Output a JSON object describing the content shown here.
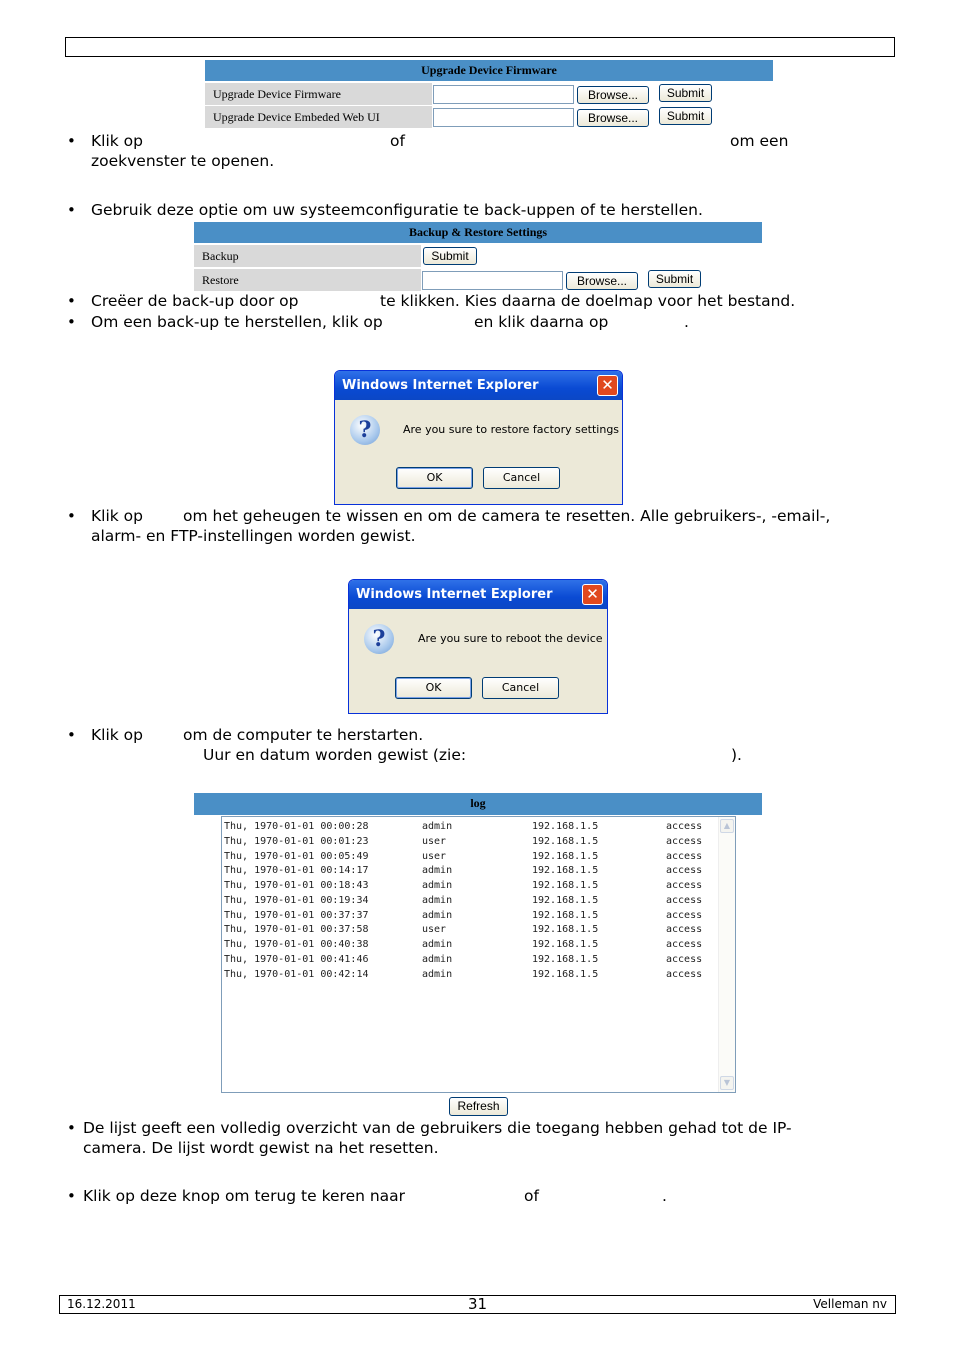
{
  "firmware_panel": {
    "title": "Upgrade Device Firmware",
    "rows": [
      {
        "label": "Upgrade Device Firmware",
        "file_value": "",
        "browse": "Browse...",
        "submit": "Submit"
      },
      {
        "label": "Upgrade Device Embeded Web UI",
        "file_value": "",
        "browse": "Browse...",
        "submit": "Submit"
      }
    ]
  },
  "text": {
    "p1_a": "Klik op",
    "p1_b": "of",
    "p1_c": "om een",
    "p1_d": "zoekvenster te openen.",
    "p2": "Gebruik deze optie om uw systeemconfiguratie te back-uppen of te herstellen.",
    "p3_a": "Creëer de back-up door op",
    "p3_b": "te klikken. Kies daarna de doelmap voor het bestand.",
    "p4_a": "Om een back-up te herstellen, klik op",
    "p4_b": "en klik daarna op",
    "p4_c": ".",
    "p5_a": "Klik op",
    "p5_b": "om het geheugen te wissen en om de camera te resetten. Alle gebruikers-, -email-,",
    "p5_c": "alarm- en FTP-instellingen worden gewist.",
    "p6_a": "Klik op",
    "p6_b": "om de computer te herstarten.",
    "p6_c": "Uur en datum worden gewist (zie:",
    "p6_d": ").",
    "p7_a": "De lijst geeft een volledig overzicht van de gebruikers die toegang hebben gehad tot de IP-",
    "p7_b": "camera. De lijst wordt gewist na het resetten.",
    "p8_a": "Klik op deze knop om terug te keren naar",
    "p8_b": "of",
    "p8_c": ".",
    "bullet": "•"
  },
  "backup_panel": {
    "title": "Backup & Restore Settings",
    "backup_label": "Backup",
    "backup_submit": "Submit",
    "restore_label": "Restore",
    "restore_file_value": "",
    "restore_browse": "Browse...",
    "restore_submit": "Submit"
  },
  "dialog_factory": {
    "title": "Windows Internet Explorer",
    "message": "Are you sure to restore factory settings",
    "ok": "OK",
    "cancel": "Cancel",
    "close": "✕",
    "icon": "?"
  },
  "dialog_reboot": {
    "title": "Windows Internet Explorer",
    "message": "Are you sure to reboot the device",
    "ok": "OK",
    "cancel": "Cancel",
    "close": "✕",
    "icon": "?"
  },
  "log_panel": {
    "title": "log",
    "entries": [
      {
        "time": "Thu, 1970-01-01 00:00:28",
        "user": "admin",
        "ip": "192.168.1.5",
        "action": "access"
      },
      {
        "time": "Thu, 1970-01-01 00:01:23",
        "user": "user",
        "ip": "192.168.1.5",
        "action": "access"
      },
      {
        "time": "Thu, 1970-01-01 00:05:49",
        "user": "user",
        "ip": "192.168.1.5",
        "action": "access"
      },
      {
        "time": "Thu, 1970-01-01 00:14:17",
        "user": "admin",
        "ip": "192.168.1.5",
        "action": "access"
      },
      {
        "time": "Thu, 1970-01-01 00:18:43",
        "user": "admin",
        "ip": "192.168.1.5",
        "action": "access"
      },
      {
        "time": "Thu, 1970-01-01 00:19:34",
        "user": "admin",
        "ip": "192.168.1.5",
        "action": "access"
      },
      {
        "time": "Thu, 1970-01-01 00:37:37",
        "user": "admin",
        "ip": "192.168.1.5",
        "action": "access"
      },
      {
        "time": "Thu, 1970-01-01 00:37:58",
        "user": "user",
        "ip": "192.168.1.5",
        "action": "access"
      },
      {
        "time": "Thu, 1970-01-01 00:40:38",
        "user": "admin",
        "ip": "192.168.1.5",
        "action": "access"
      },
      {
        "time": "Thu, 1970-01-01 00:41:46",
        "user": "admin",
        "ip": "192.168.1.5",
        "action": "access"
      },
      {
        "time": "Thu, 1970-01-01 00:42:14",
        "user": "admin",
        "ip": "192.168.1.5",
        "action": "access"
      }
    ],
    "refresh": "Refresh",
    "scroll_up": "▲",
    "scroll_down": "▼"
  },
  "footer": {
    "date": "16.12.2011",
    "page": "31",
    "company": "Velleman nv"
  }
}
